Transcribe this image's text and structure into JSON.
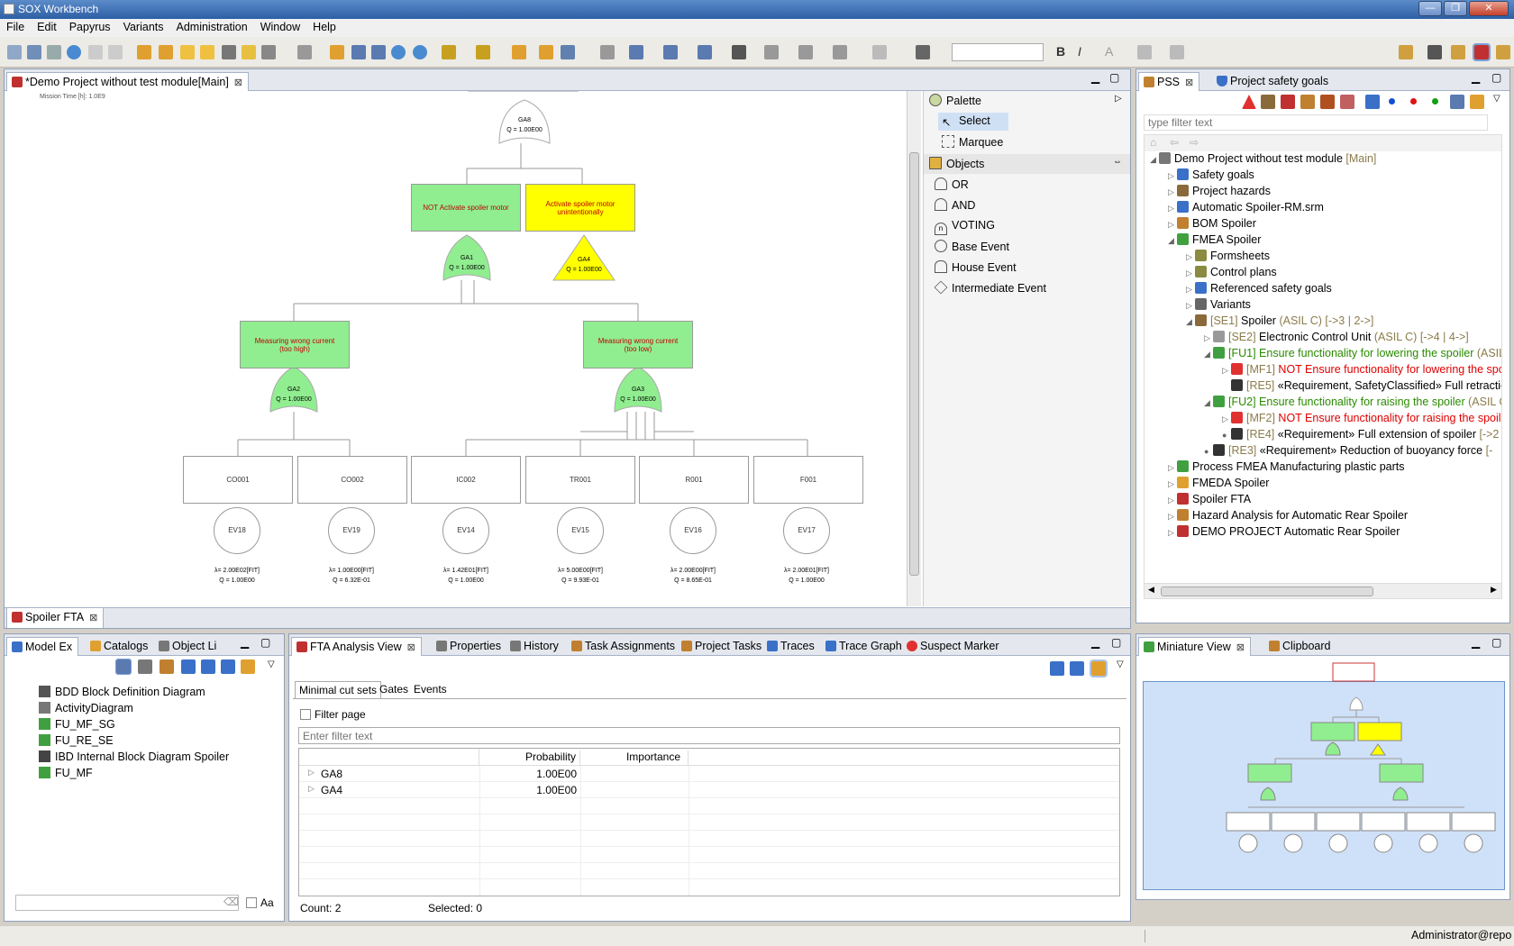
{
  "app": {
    "title": "SOX Workbench",
    "status_user": "Administrator@repo"
  },
  "menu": [
    "File",
    "Edit",
    "Papyrus",
    "Variants",
    "Administration",
    "Window",
    "Help"
  ],
  "editor": {
    "tab": "*Demo Project without test module[Main]",
    "mission_time": "Mission Time [h]: 1.0E9",
    "bottom_tab": "Spoiler FTA",
    "top_gate": {
      "id": "GA8",
      "q": "Q = 1.00E00"
    },
    "events": {
      "left_title": "NOT Activate spoiler motor",
      "right_title": "Activate spoiler motor unintentionally",
      "m1": "Measuring wrong current (too high)",
      "m2": "Measuring wrong current (too low)"
    },
    "gates": [
      {
        "id": "GA1",
        "q": "Q = 1.00E00"
      },
      {
        "id": "GA4",
        "q": "Q = 1.00E00"
      },
      {
        "id": "GA2",
        "q": "Q = 1.00E00"
      },
      {
        "id": "GA3",
        "q": "Q = 1.00E00"
      }
    ],
    "basics": [
      {
        "name": "CO001",
        "ev": "EV18",
        "rate": "λ= 2.00E02[FIT]",
        "q": "Q = 1.00E00"
      },
      {
        "name": "CO002",
        "ev": "EV19",
        "rate": "λ= 1.00E00[FIT]",
        "q": "Q = 6.32E-01"
      },
      {
        "name": "IC002",
        "ev": "EV14",
        "rate": "λ= 1.42E01[FIT]",
        "q": "Q = 1.00E00"
      },
      {
        "name": "TR001",
        "ev": "EV15",
        "rate": "λ= 5.00E00[FIT]",
        "q": "Q = 9.93E-01"
      },
      {
        "name": "R001",
        "ev": "EV16",
        "rate": "λ= 2.00E00[FIT]",
        "q": "Q = 8.65E-01"
      },
      {
        "name": "F001",
        "ev": "EV17",
        "rate": "λ= 2.00E01[FIT]",
        "q": "Q = 1.00E00"
      }
    ]
  },
  "palette": {
    "title": "Palette",
    "select": "Select",
    "marquee": "Marquee",
    "objects": "Objects",
    "items": [
      "OR",
      "AND",
      "VOTING",
      "Base Event",
      "House Event",
      "Intermediate Event"
    ]
  },
  "pss": {
    "tab1": "PSS",
    "tab2": "Project safety goals",
    "filter_placeholder": "type filter text",
    "tree": [
      {
        "pre": "Demo Project without test module",
        "post": " [Main]"
      },
      {
        "pre": "Safety goals"
      },
      {
        "pre": "Project hazards"
      },
      {
        "pre": "Automatic Spoiler-RM.srm"
      },
      {
        "pre": "BOM Spoiler"
      },
      {
        "pre": "FMEA Spoiler"
      },
      {
        "pre": "Formsheets"
      },
      {
        "pre": "Control plans"
      },
      {
        "pre": "Referenced safety goals"
      },
      {
        "pre": "Variants"
      },
      {
        "a": "[SE1] ",
        "pre": "Spoiler",
        "post": " (ASIL C) [->3 | 2->]"
      },
      {
        "a": "[SE2] ",
        "pre": "Electronic Control Unit",
        "post": " (ASIL C) [->4 | 4->]"
      },
      {
        "a": "[FU1] ",
        "pre": "Ensure functionality for lowering the spoiler",
        "post": " (ASIL C"
      },
      {
        "a": "[MF1] ",
        "pre": "NOT Ensure functionality for lowering the spoi"
      },
      {
        "a": "[RE5] ",
        "pre": "«Requirement, SafetyClassified» Full retractic"
      },
      {
        "a": "[FU2] ",
        "pre": "Ensure functionality for raising the spoiler",
        "post": " (ASIL C)"
      },
      {
        "a": "[MF2] ",
        "pre": "NOT Ensure functionality for raising the spoiler"
      },
      {
        "a": "[RE4] ",
        "pre": "«Requirement» Full extension of spoiler",
        "post": " [->2"
      },
      {
        "a": "[RE3] ",
        "pre": "«Requirement» Reduction of buoyancy force",
        "post": " [-"
      },
      {
        "pre": "Process FMEA Manufacturing plastic parts"
      },
      {
        "pre": "FMEDA Spoiler"
      },
      {
        "pre": "Spoiler FTA"
      },
      {
        "pre": "Hazard Analysis for Automatic Rear Spoiler"
      },
      {
        "pre": "DEMO PROJECT Automatic Rear Spoiler"
      }
    ]
  },
  "model": {
    "tabs": [
      "Model Ex",
      "Catalogs",
      "Object Li"
    ],
    "items": [
      "BDD Block Definition Diagram",
      "ActivityDiagram",
      "FU_MF_SG",
      "FU_RE_SE",
      "IBD Internal Block Diagram Spoiler",
      "FU_MF"
    ],
    "aa": "Aa"
  },
  "analysis": {
    "tabs": [
      "FTA Analysis View",
      "Properties",
      "History",
      "Task Assignments",
      "Project Tasks",
      "Traces",
      "Trace Graph",
      "Suspect Marker"
    ],
    "subtabs": [
      "Minimal cut sets",
      "Gates",
      "Events"
    ],
    "filter_page": "Filter page",
    "filter_placeholder": "Enter filter text",
    "columns": [
      "",
      "Probability",
      "Importance"
    ],
    "rows": [
      {
        "name": "GA8",
        "prob": "1.00E00",
        "imp": ""
      },
      {
        "name": "GA4",
        "prob": "1.00E00",
        "imp": ""
      }
    ],
    "count": "Count: 2",
    "selected": "Selected: 0"
  },
  "mini": {
    "tab1": "Miniature View",
    "tab2": "Clipboard"
  }
}
